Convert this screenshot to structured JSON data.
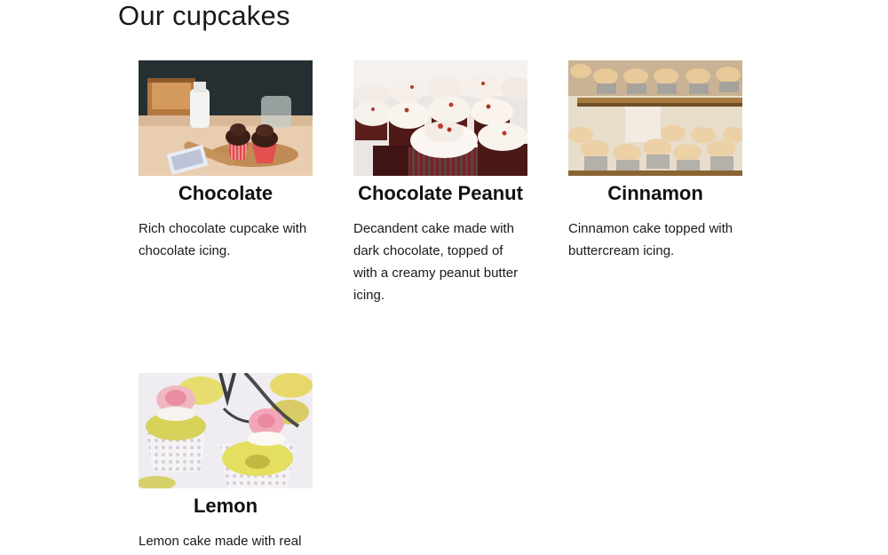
{
  "page": {
    "title": "Our cupcakes"
  },
  "cupcakes": [
    {
      "name": "Chocolate",
      "description": "Rich chocolate cupcake with chocolate icing.",
      "image_alt": "Two chocolate cupcakes on a wooden board with a milk bottle"
    },
    {
      "name": "Chocolate Peanut",
      "description": "Decandent cake made with dark chocolate, topped of with a creamy peanut butter icing.",
      "image_alt": "Chocolate cupcakes with white frosting and sprinkles"
    },
    {
      "name": "Cinnamon",
      "description": "Cinnamon cake topped with buttercream icing.",
      "image_alt": "Tiered stand of cupcakes with buttercream"
    },
    {
      "name": "Lemon",
      "description": "Lemon cake made with real",
      "image_alt": "Lemon cupcakes in lace wrappers with pink roses"
    }
  ],
  "colors": {
    "text": "#111111",
    "background": "#ffffff"
  }
}
